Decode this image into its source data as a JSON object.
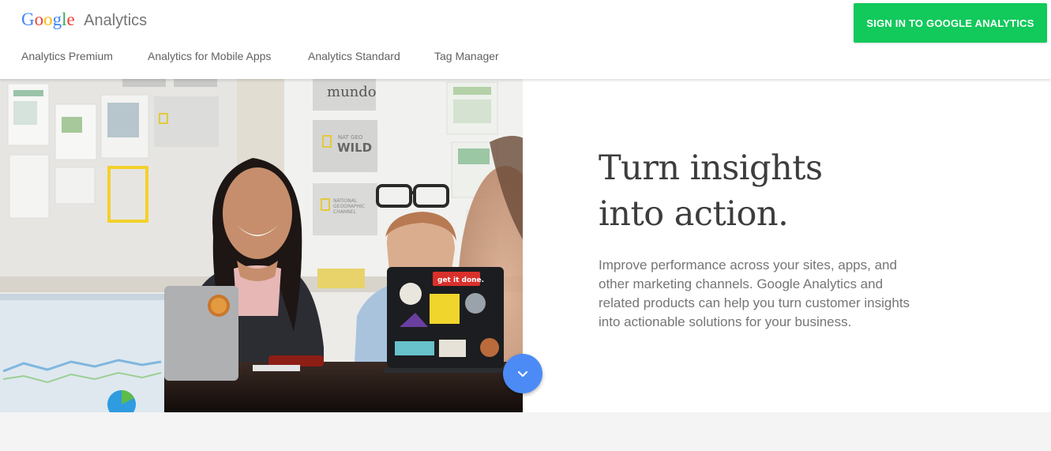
{
  "brand": {
    "google_letters": [
      {
        "ch": "G",
        "color": "#4285f4"
      },
      {
        "ch": "o",
        "color": "#ea4335"
      },
      {
        "ch": "o",
        "color": "#fbbc05"
      },
      {
        "ch": "g",
        "color": "#4285f4"
      },
      {
        "ch": "l",
        "color": "#34a853"
      },
      {
        "ch": "e",
        "color": "#ea4335"
      }
    ],
    "product": "Analytics"
  },
  "nav": {
    "items": [
      {
        "label": "Analytics Premium"
      },
      {
        "label": "Analytics for Mobile Apps"
      },
      {
        "label": "Analytics Standard"
      },
      {
        "label": "Tag Manager"
      }
    ]
  },
  "header": {
    "signin_label": "SIGN IN TO GOOGLE ANALYTICS",
    "signin_color": "#12c95b"
  },
  "hero": {
    "headline_line1": "Turn insights",
    "headline_line2": "into action.",
    "body": "Improve performance across your sites, apps, and other marketing channels. Google Analytics and related products can help you turn customer insights into actionable solutions for your business.",
    "photo_text": {
      "mundo": "mundo",
      "natgeo_small": "NAT GEO",
      "wild": "WILD",
      "national": "NATIONAL",
      "geographic": "GEOGRAPHIC",
      "channel": "CHANNEL",
      "sticker": "get it done."
    },
    "scroll_icon": "chevron-down-icon",
    "scroll_color": "#4c8bf5"
  }
}
